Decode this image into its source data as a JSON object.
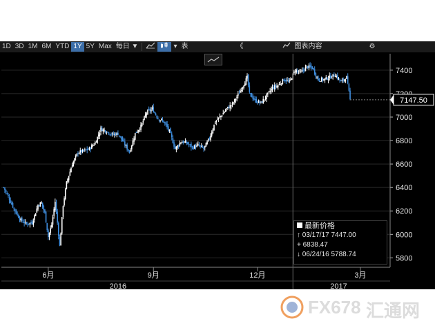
{
  "toolbar": {
    "periods": [
      "1D",
      "3D",
      "1M",
      "6M",
      "YTD",
      "1Y",
      "5Y",
      "Max"
    ],
    "selected_period": "1Y",
    "frequency": "每日 ▼",
    "chart_type_label": "表",
    "collapse_glyph": "《",
    "chart_content_label": "图表内容",
    "settings_glyph": "⚙"
  },
  "legend": {
    "title": "最新价格",
    "high": "03/17/17 7447.00",
    "avg": "6838.47",
    "low": "06/24/16 5788.74"
  },
  "watermark": {
    "brand": "FX678",
    "cn": "汇通网"
  },
  "chart_data": {
    "type": "candlestick",
    "last_price_label": "7147.50",
    "y_ticks": [
      5800,
      6000,
      6200,
      6400,
      6600,
      6800,
      7000,
      7200,
      7400
    ],
    "ylim": [
      5720,
      7540
    ],
    "x_month_labels": [
      {
        "label": "6月",
        "day": 39
      },
      {
        "label": "9月",
        "day": 131
      },
      {
        "label": "12月",
        "day": 222
      },
      {
        "label": "3月",
        "day": 312
      }
    ],
    "x_year_labels": [
      {
        "label": "2016",
        "day": 100
      },
      {
        "label": "2017",
        "day": 293
      }
    ],
    "year_boundary_day": 253,
    "x_range_days": [
      -2,
      338
    ],
    "close_path": [
      [
        0,
        6400
      ],
      [
        5,
        6300
      ],
      [
        10,
        6200
      ],
      [
        15,
        6120
      ],
      [
        20,
        6090
      ],
      [
        25,
        6100
      ],
      [
        30,
        6250
      ],
      [
        33,
        6270
      ],
      [
        36,
        6180
      ],
      [
        39,
        5980
      ],
      [
        42,
        6080
      ],
      [
        45,
        6280
      ],
      [
        47,
        6100
      ],
      [
        49,
        5900
      ],
      [
        52,
        6250
      ],
      [
        55,
        6440
      ],
      [
        60,
        6600
      ],
      [
        65,
        6700
      ],
      [
        70,
        6710
      ],
      [
        75,
        6730
      ],
      [
        80,
        6780
      ],
      [
        85,
        6900
      ],
      [
        90,
        6880
      ],
      [
        95,
        6850
      ],
      [
        100,
        6860
      ],
      [
        105,
        6780
      ],
      [
        110,
        6700
      ],
      [
        115,
        6860
      ],
      [
        120,
        6920
      ],
      [
        125,
        7040
      ],
      [
        130,
        7070
      ],
      [
        135,
        6990
      ],
      [
        140,
        6960
      ],
      [
        145,
        6880
      ],
      [
        150,
        6730
      ],
      [
        155,
        6790
      ],
      [
        160,
        6780
      ],
      [
        165,
        6740
      ],
      [
        170,
        6760
      ],
      [
        175,
        6730
      ],
      [
        180,
        6820
      ],
      [
        185,
        6960
      ],
      [
        190,
        7010
      ],
      [
        195,
        7070
      ],
      [
        200,
        7110
      ],
      [
        205,
        7190
      ],
      [
        210,
        7280
      ],
      [
        213,
        7340
      ],
      [
        215,
        7200
      ],
      [
        220,
        7140
      ],
      [
        225,
        7120
      ],
      [
        230,
        7180
      ],
      [
        235,
        7250
      ],
      [
        240,
        7270
      ],
      [
        245,
        7320
      ],
      [
        250,
        7300
      ],
      [
        255,
        7400
      ],
      [
        260,
        7380
      ],
      [
        265,
        7430
      ],
      [
        270,
        7420
      ],
      [
        275,
        7320
      ],
      [
        280,
        7320
      ],
      [
        285,
        7340
      ],
      [
        290,
        7360
      ],
      [
        295,
        7300
      ],
      [
        300,
        7340
      ],
      [
        303,
        7147.5
      ]
    ]
  }
}
